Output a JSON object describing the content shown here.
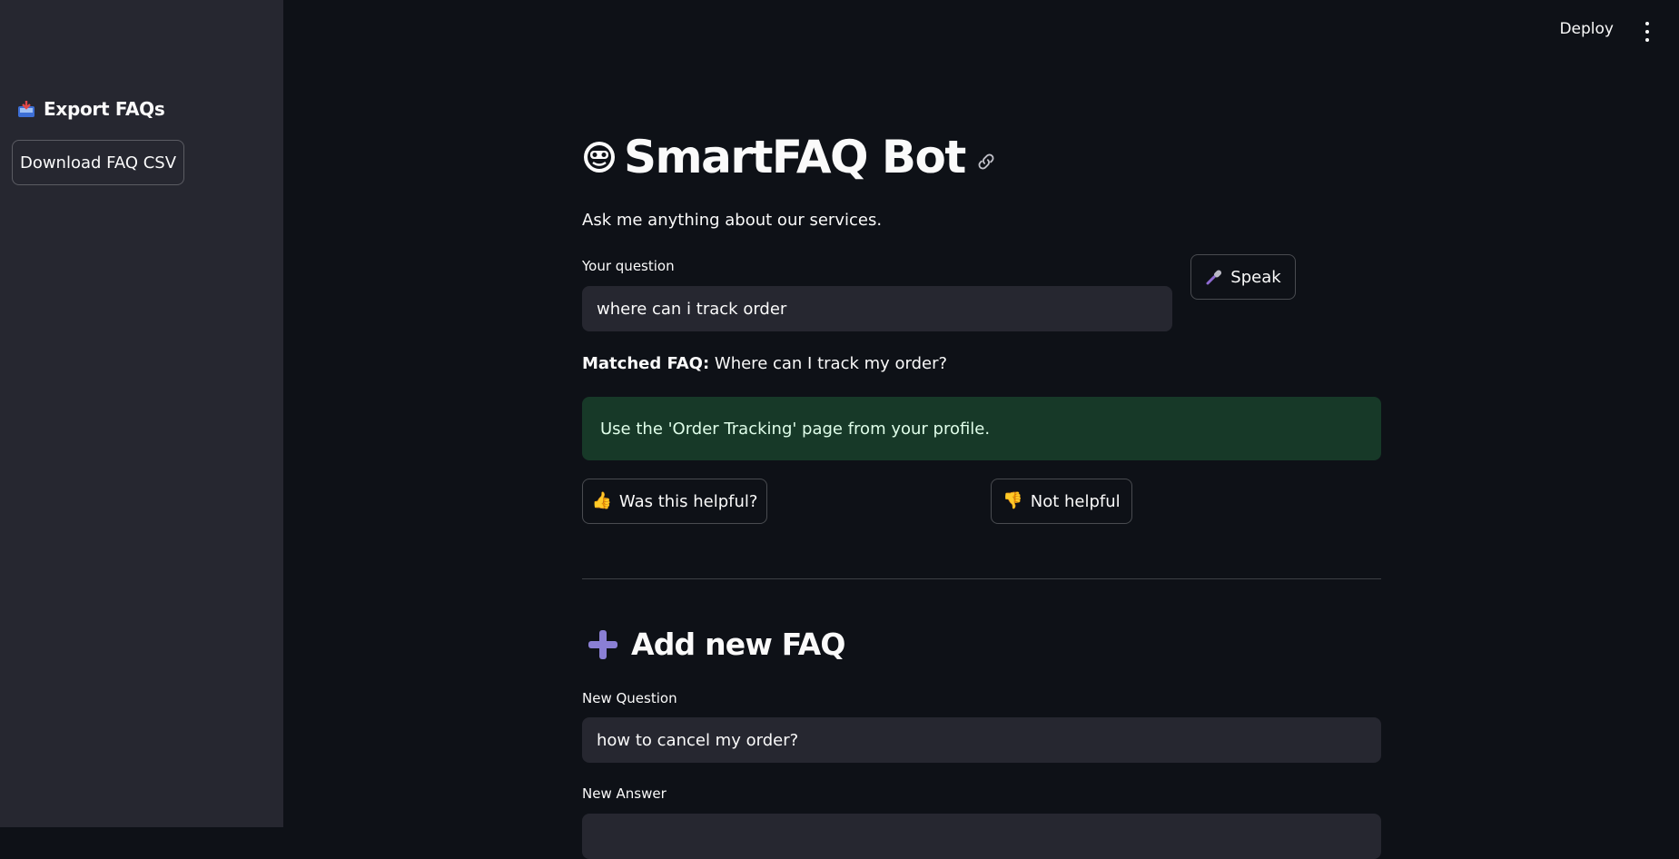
{
  "topbar": {
    "deploy_label": "Deploy"
  },
  "sidebar": {
    "header": "Export FAQs",
    "download_button": "Download FAQ CSV"
  },
  "main": {
    "title": "SmartFAQ Bot",
    "subtitle": "Ask me anything about our services.",
    "question_label": "Your question",
    "question_value": "where can i track order",
    "speak_label": "Speak",
    "matched_prefix": "Matched FAQ:",
    "matched_value": "Where can I track my order?",
    "answer": "Use the 'Order Tracking' page from your profile.",
    "helpful_label": "Was this helpful?",
    "not_helpful_label": "Not helpful",
    "helpful_emoji": "👍",
    "not_helpful_emoji": "👎"
  },
  "add_faq": {
    "title": "Add new FAQ",
    "question_label": "New Question",
    "question_value": "how to cancel my order?",
    "answer_label": "New Answer",
    "answer_value": ""
  },
  "colors": {
    "background": "#0e1117",
    "sidebar": "#262730",
    "success": "#173928",
    "accent_plus": "#8a7fd4"
  }
}
